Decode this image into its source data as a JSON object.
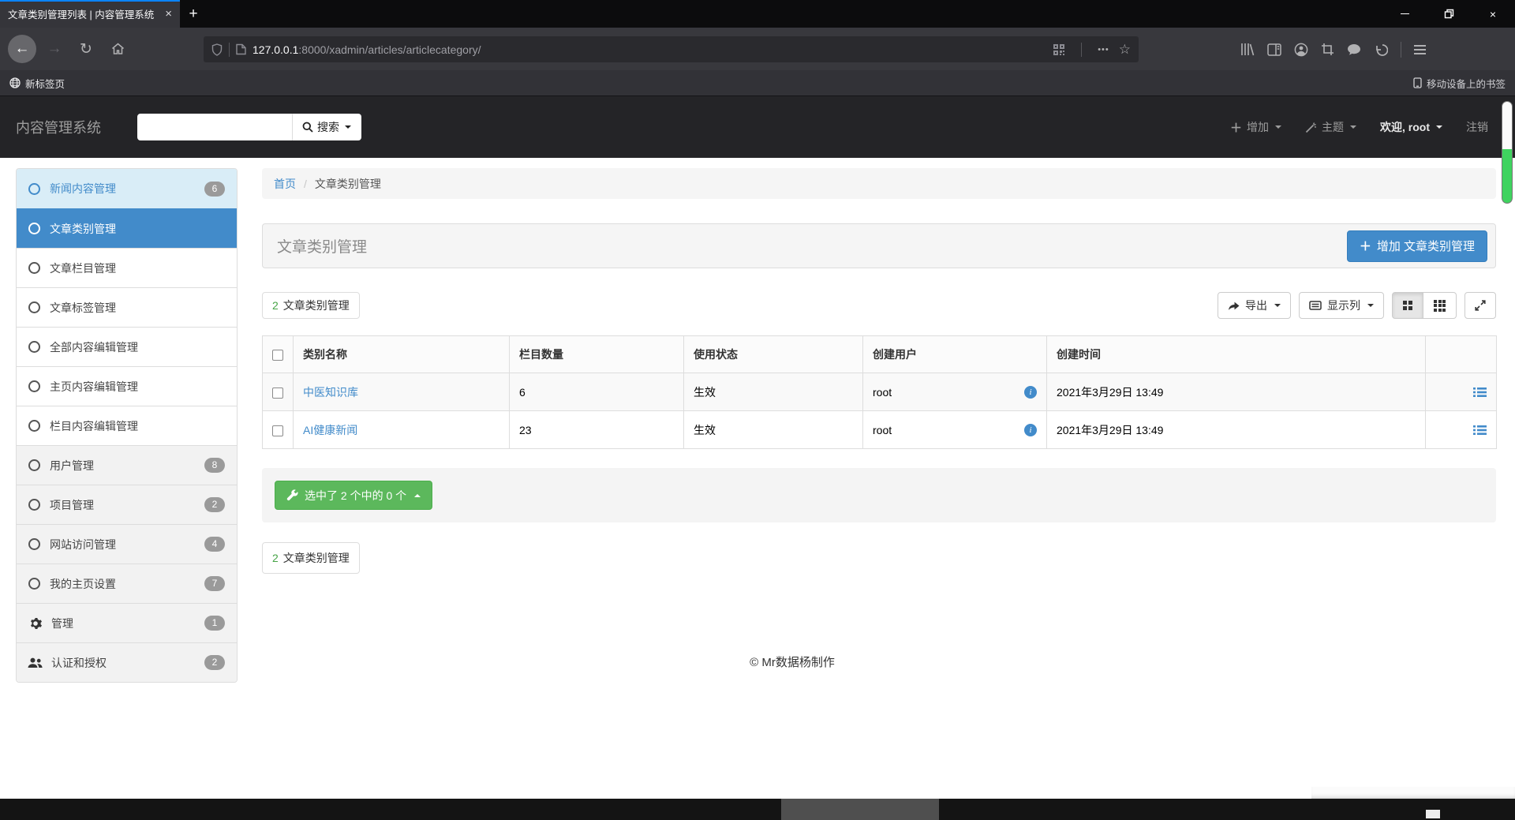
{
  "colors": {
    "accent": "#428bca",
    "success": "#5cb85c",
    "info_bg": "#d9edf7",
    "badge": "#9a9a9a",
    "firefox_tab_accent": "#0a84ff",
    "scroll_green": "#3fd35f"
  },
  "browser": {
    "tab_title": "文章类别管理列表 | 内容管理系统",
    "url_host": "127.0.0.1",
    "url_rest": ":8000/xadmin/articles/articlecategory/",
    "bookmark_left": "新标签页",
    "bookmark_right": "移动设备上的书签"
  },
  "icons": {
    "tab_close": "×",
    "new_tab": "+",
    "win_close": "×",
    "back": "←",
    "forward": "→",
    "reload": "↻",
    "dots": "•••",
    "star": "☆",
    "info_i": "i"
  },
  "app_navbar": {
    "brand": "内容管理系统",
    "search_value": "",
    "search_label": "搜索",
    "add_label": "增加",
    "theme_label": "主题",
    "welcome_label": "欢迎, root",
    "logout_label": "注销"
  },
  "sidebar": {
    "items": [
      {
        "label": "新闻内容管理",
        "badge": "6"
      },
      {
        "label": "文章类别管理",
        "badge": ""
      },
      {
        "label": "文章栏目管理",
        "badge": ""
      },
      {
        "label": "文章标签管理",
        "badge": ""
      },
      {
        "label": "全部内容编辑管理",
        "badge": ""
      },
      {
        "label": "主页内容编辑管理",
        "badge": ""
      },
      {
        "label": "栏目内容编辑管理",
        "badge": ""
      },
      {
        "label": "用户管理",
        "badge": "8"
      },
      {
        "label": "项目管理",
        "badge": "2"
      },
      {
        "label": "网站访问管理",
        "badge": "4"
      },
      {
        "label": "我的主页设置",
        "badge": "7"
      },
      {
        "label": "管理",
        "badge": "1"
      },
      {
        "label": "认证和授权",
        "badge": "2"
      }
    ]
  },
  "breadcrumb": {
    "home": "首页",
    "separator": "/",
    "current": "文章类别管理"
  },
  "panel": {
    "title": "文章类别管理",
    "add_button_label": "增加 文章类别管理"
  },
  "list_toolbar": {
    "count": "2",
    "count_label": "文章类别管理",
    "export_label": "导出",
    "columns_label": "显示列"
  },
  "table": {
    "headers": {
      "name": "类别名称",
      "count": "栏目数量",
      "status": "使用状态",
      "user": "创建用户",
      "time": "创建时间"
    },
    "rows": [
      {
        "name": "中医知识库",
        "count": "6",
        "status": "生效",
        "user": "root",
        "time": "2021年3月29日 13:49"
      },
      {
        "name": "AI健康新闻",
        "count": "23",
        "status": "生效",
        "user": "root",
        "time": "2021年3月29日 13:49"
      }
    ]
  },
  "bulk_actions": {
    "selected_label": "选中了 2 个中的 0 个"
  },
  "bottom_count": {
    "count": "2",
    "label": "文章类别管理"
  },
  "footer": {
    "copyright": "© Mr数据杨制作"
  }
}
